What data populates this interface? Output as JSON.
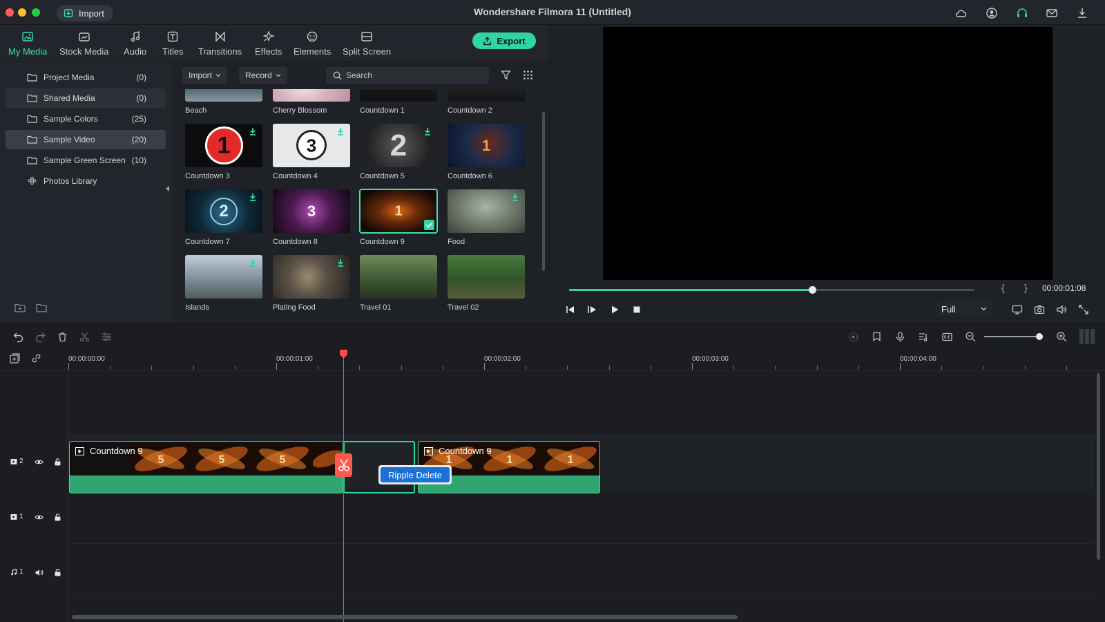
{
  "titlebar": {
    "import_label": "Import",
    "app_title": "Wondershare Filmora 11 (Untitled)"
  },
  "media_tabs": [
    {
      "label": "My Media",
      "icon": "image-icon",
      "active": true
    },
    {
      "label": "Stock Media",
      "icon": "stock-media-icon"
    },
    {
      "label": "Audio",
      "icon": "music-note-icon"
    },
    {
      "label": "Titles",
      "icon": "title-t-icon"
    },
    {
      "label": "Transitions",
      "icon": "transition-bowtie-icon"
    },
    {
      "label": "Effects",
      "icon": "effects-sparkle-icon"
    },
    {
      "label": "Elements",
      "icon": "elements-icon"
    },
    {
      "label": "Split Screen",
      "icon": "split-screen-icon"
    }
  ],
  "export_label": "Export",
  "sidebar": {
    "items": [
      {
        "label": "Project Media",
        "count": "(0)"
      },
      {
        "label": "Shared Media",
        "count": "(0)"
      },
      {
        "label": "Sample Colors",
        "count": "(25)"
      },
      {
        "label": "Sample Video",
        "count": "(20)"
      },
      {
        "label": "Sample Green Screen",
        "count": "(10)"
      },
      {
        "label": "Photos Library",
        "count": ""
      }
    ]
  },
  "media_toolbar": {
    "import_label": "Import",
    "record_label": "Record",
    "search_placeholder": "Search"
  },
  "media_tiles": [
    {
      "name": "Beach"
    },
    {
      "name": "Cherry Blossom"
    },
    {
      "name": "Countdown 1"
    },
    {
      "name": "Countdown 2"
    },
    {
      "name": "Countdown 3",
      "num": "1"
    },
    {
      "name": "Countdown 4",
      "num": "3"
    },
    {
      "name": "Countdown 5",
      "num": "2"
    },
    {
      "name": "Countdown 6",
      "num": "1"
    },
    {
      "name": "Countdown 7",
      "num": "2"
    },
    {
      "name": "Countdown 8",
      "num": "3"
    },
    {
      "name": "Countdown 9",
      "num": "1",
      "selected": true
    },
    {
      "name": "Food"
    },
    {
      "name": "Islands"
    },
    {
      "name": "Plating Food"
    },
    {
      "name": "Travel 01"
    },
    {
      "name": "Travel 02"
    }
  ],
  "preview": {
    "timecode": "00:00:01:08",
    "progress": 0.6,
    "brace_open": "{",
    "brace_close": "}",
    "quality": "Full"
  },
  "timeline": {
    "ruler_labels": [
      "00:00:00:00",
      "00:00:01:00",
      "00:00:02:00",
      "00:00:03:00",
      "00:00:04:00"
    ],
    "zoom_level": 0.97,
    "tracks": [
      {
        "label": "2",
        "kind": "video"
      },
      {
        "label": "1",
        "kind": "video"
      },
      {
        "label": "1",
        "kind": "audio"
      }
    ],
    "clip1_title": "Countdown 9",
    "clip2_title": "Countdown 9",
    "clip1_frames": [
      "5",
      "5",
      "5"
    ],
    "clip2_frames": [
      "1",
      "1",
      "1"
    ],
    "context_menu_label": "Ripple Delete"
  },
  "colors": {
    "accent": "#2fd6a2",
    "clip_green": "#2fa670",
    "playhead_red": "#ff4b4b",
    "menu_blue": "#1b6fd6"
  }
}
